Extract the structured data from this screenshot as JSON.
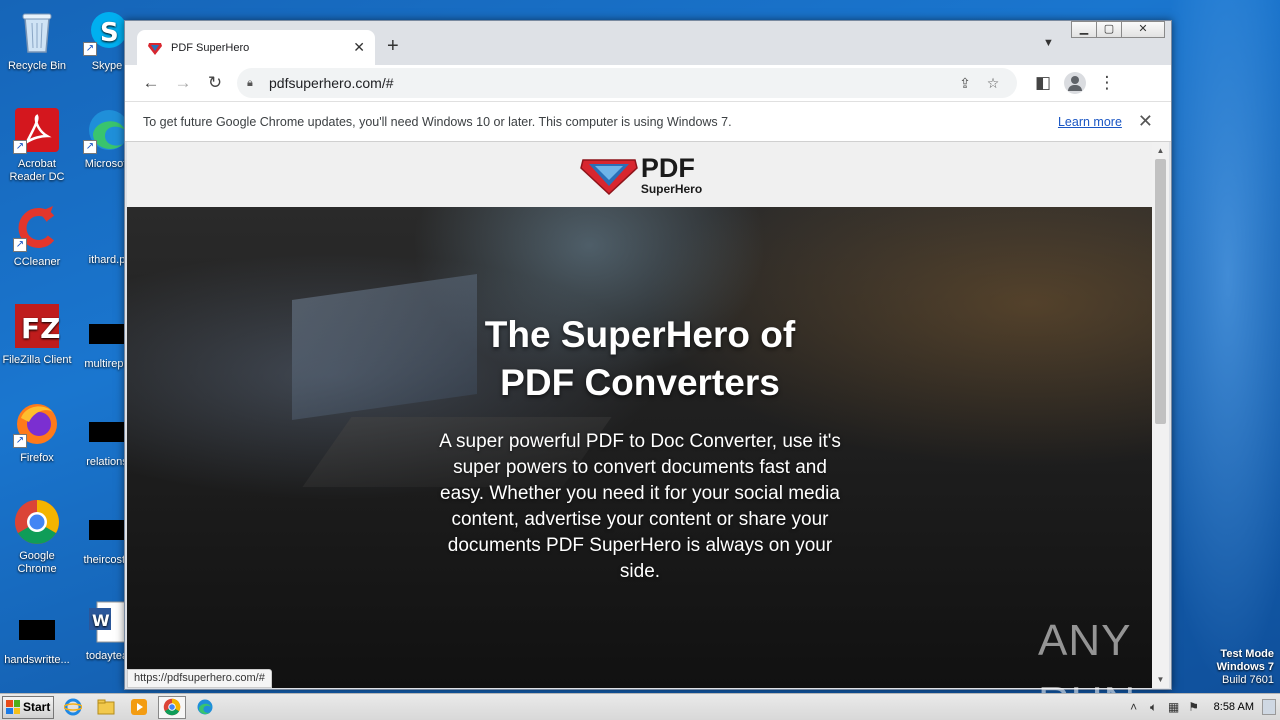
{
  "desktop": {
    "icons": [
      {
        "label": "Recycle Bin"
      },
      {
        "label": "Skype"
      },
      {
        "label": "Acrobat Reader DC"
      },
      {
        "label": "Microsoft"
      },
      {
        "label": "CCleaner"
      },
      {
        "label": "ithard.p"
      },
      {
        "label": "FileZilla Client"
      },
      {
        "label": "multirepo"
      },
      {
        "label": "Firefox"
      },
      {
        "label": "relations"
      },
      {
        "label": "Google Chrome"
      },
      {
        "label": "theircosts"
      },
      {
        "label": "handswritte..."
      },
      {
        "label": "todaytea"
      }
    ]
  },
  "browser": {
    "tab": {
      "title": "PDF SuperHero"
    },
    "address": {
      "url": "pdfsuperhero.com/#"
    },
    "infobar": {
      "message": "To get future Google Chrome updates, you'll need Windows 10 or later. This computer is using Windows 7.",
      "link": "Learn more"
    },
    "status_url": "https://pdfsuperhero.com/#"
  },
  "page": {
    "logo": {
      "pdf": "PDF",
      "sub": "SuperHero"
    },
    "hero": {
      "title_line1": "The SuperHero of",
      "title_line2": "PDF Converters",
      "description": "A super powerful PDF to Doc Converter, use it's super powers to convert documents fast and easy. Whether you need it for your social media content, advertise your content or share your documents PDF SuperHero is always on your side."
    }
  },
  "watermark": {
    "text": "ANY RUN"
  },
  "testmode": {
    "line1": "Test Mode",
    "line2": "Windows 7",
    "line3": "Build 7601"
  },
  "taskbar": {
    "start_label": "Start",
    "clock": "8:58 AM"
  },
  "colors": {
    "accent": "#1a56c4",
    "logo_red": "#d8262f",
    "logo_blue": "#2a6fb8"
  }
}
